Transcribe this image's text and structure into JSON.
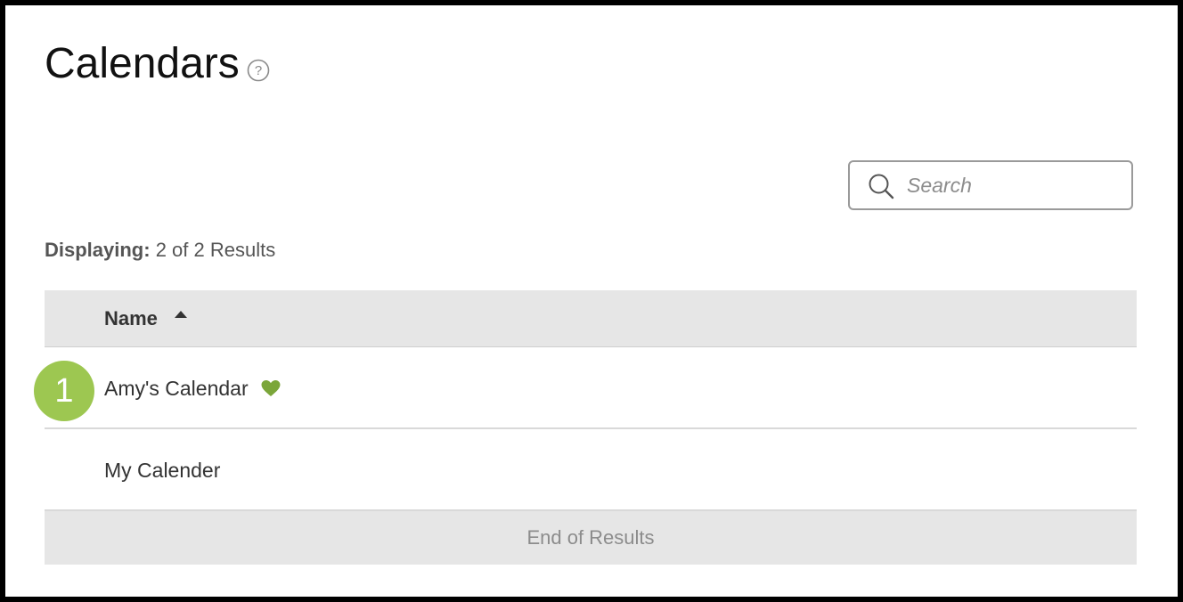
{
  "page": {
    "title": "Calendars",
    "help_icon": "question-circle-icon"
  },
  "search": {
    "placeholder": "Search",
    "value": "",
    "icon": "search-icon"
  },
  "results": {
    "label": "Displaying:",
    "summary": "2 of 2 Results"
  },
  "table": {
    "columns": [
      {
        "label": "Name",
        "sort": "ascending",
        "sort_icon": "caret-up-icon"
      }
    ],
    "rows": [
      {
        "name": "Amy's Calendar",
        "favorite": true,
        "icon": "heart-icon"
      },
      {
        "name": "My Calender",
        "favorite": false
      }
    ],
    "footer": "End of Results"
  },
  "annotation": {
    "step": "1"
  },
  "colors": {
    "accent_green": "#7ba63a",
    "badge_green": "#9dc751",
    "header_bg": "#e6e6e6"
  }
}
